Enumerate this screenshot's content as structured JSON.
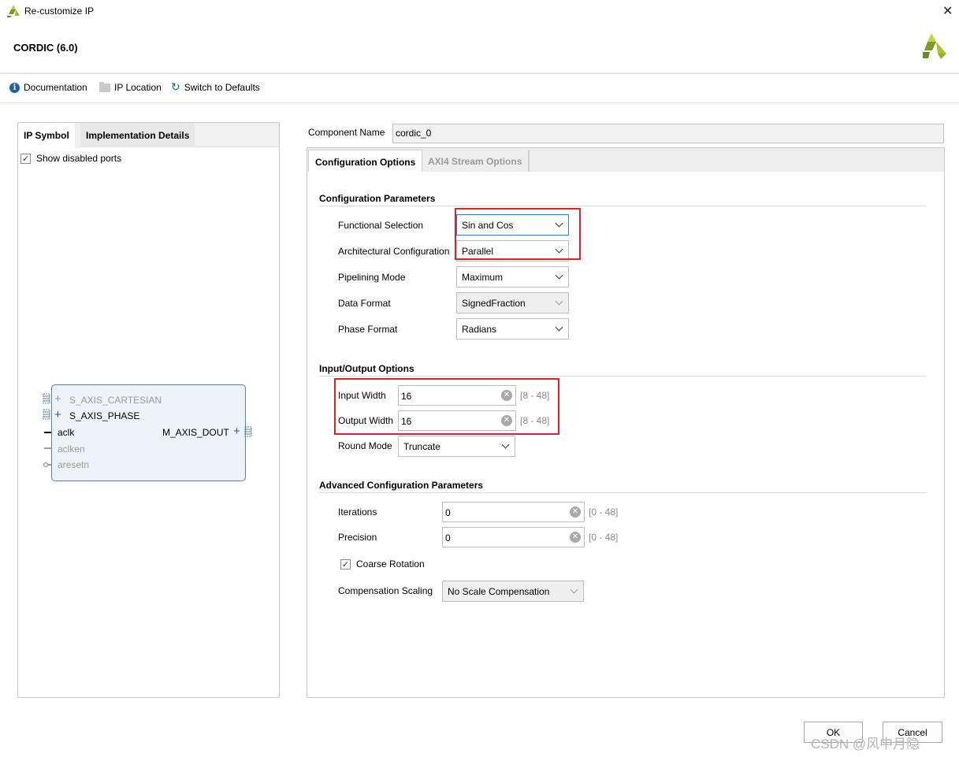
{
  "window": {
    "title": "Re-customize IP",
    "close_glyph": "✕",
    "ip_name": "CORDIC (6.0)"
  },
  "toolbar": {
    "documentation": "Documentation",
    "ip_location": "IP Location",
    "switch_defaults": "Switch to Defaults"
  },
  "left_panel": {
    "tabs": [
      "IP Symbol",
      "Implementation Details"
    ],
    "show_disabled_ports": "Show disabled ports",
    "show_disabled_checked": true,
    "symbol": {
      "inputs": [
        {
          "name": "S_AXIS_CARTESIAN",
          "enabled": false
        },
        {
          "name": "S_AXIS_PHASE",
          "enabled": true
        },
        {
          "name": "aclk",
          "enabled": true
        },
        {
          "name": "aclken",
          "enabled": false
        },
        {
          "name": "aresetn",
          "enabled": false
        }
      ],
      "outputs": [
        {
          "name": "M_AXIS_DOUT",
          "enabled": true
        }
      ]
    }
  },
  "component": {
    "label": "Component Name",
    "value": "cordic_0"
  },
  "config": {
    "tabs": [
      "Configuration Options",
      "AXI4 Stream Options"
    ],
    "sections": {
      "config_params": "Configuration Parameters",
      "io_options": "Input/Output Options",
      "advanced": "Advanced Configuration Parameters"
    },
    "functional_selection": {
      "label": "Functional Selection",
      "value": "Sin and Cos"
    },
    "architectural_configuration": {
      "label": "Architectural Configuration",
      "value": "Parallel"
    },
    "pipelining_mode": {
      "label": "Pipelining Mode",
      "value": "Maximum"
    },
    "data_format": {
      "label": "Data Format",
      "value": "SignedFraction"
    },
    "phase_format": {
      "label": "Phase Format",
      "value": "Radians"
    },
    "input_width": {
      "label": "Input Width",
      "value": "16",
      "range": "[8 - 48]"
    },
    "output_width": {
      "label": "Output Width",
      "value": "16",
      "range": "[8 - 48]"
    },
    "round_mode": {
      "label": "Round Mode",
      "value": "Truncate"
    },
    "iterations": {
      "label": "Iterations",
      "value": "0",
      "range": "[0 - 48]"
    },
    "precision": {
      "label": "Precision",
      "value": "0",
      "range": "[0 - 48]"
    },
    "coarse_rotation": {
      "label": "Coarse Rotation",
      "checked": true
    },
    "compensation_scaling": {
      "label": "Compensation Scaling",
      "value": "No Scale Compensation"
    }
  },
  "buttons": {
    "ok": "OK",
    "cancel": "Cancel"
  },
  "watermark": "CSDN @风中月隐",
  "colors": {
    "highlight_red": "#e0202a",
    "focus_blue": "#3e75c9",
    "logo_green": "#8bad2d"
  }
}
